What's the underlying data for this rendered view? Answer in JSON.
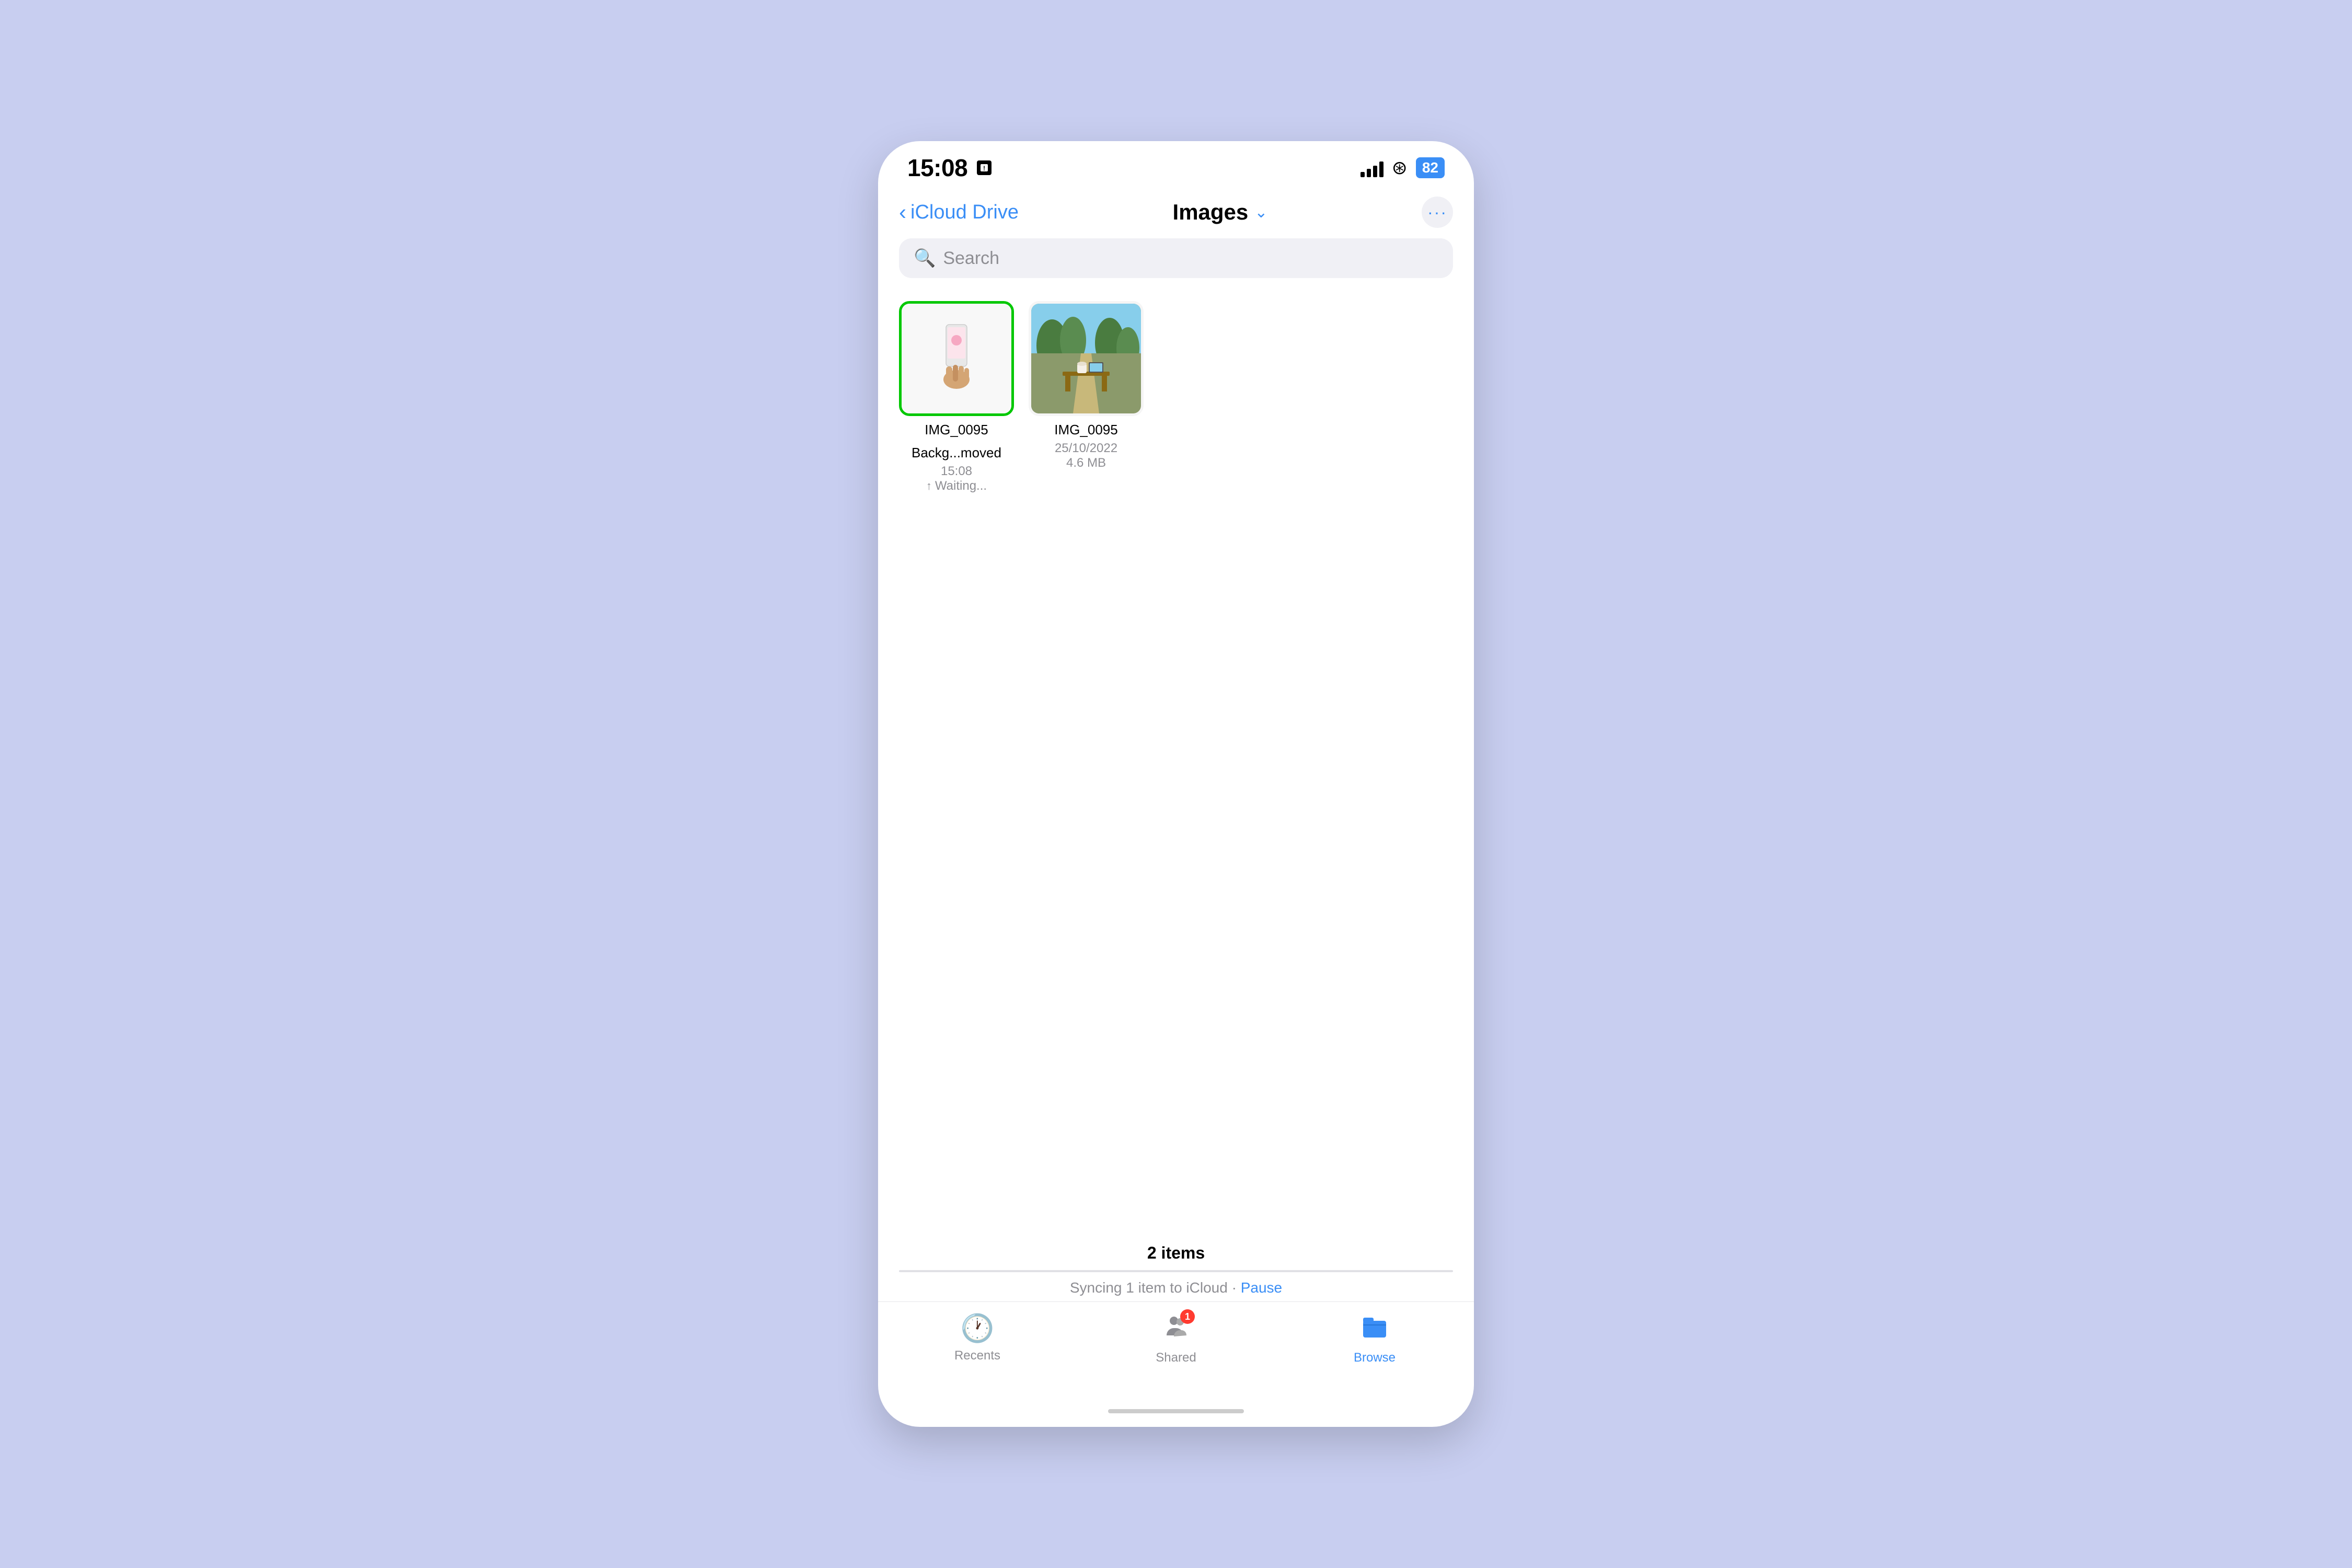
{
  "status_bar": {
    "time": "15:08",
    "battery": "82"
  },
  "nav": {
    "back_label": "iCloud Drive",
    "title": "Images",
    "more_dots": "···"
  },
  "search": {
    "placeholder": "Search"
  },
  "files": [
    {
      "id": "file1",
      "name": "IMG_0095",
      "subtitle": "Backg...moved",
      "date": "15:08",
      "status": "↑ Waiting...",
      "selected": true,
      "type": "phone"
    },
    {
      "id": "file2",
      "name": "IMG_0095",
      "subtitle": "",
      "date": "25/10/2022",
      "size": "4.6 MB",
      "selected": false,
      "type": "outdoor"
    }
  ],
  "bottom": {
    "items_count": "2 items",
    "sync_text": "Syncing 1 item to iCloud",
    "pause_label": "Pause"
  },
  "tabs": [
    {
      "id": "recents",
      "label": "Recents",
      "icon": "🕐",
      "active": false
    },
    {
      "id": "shared",
      "label": "Shared",
      "icon": "📁",
      "active": false,
      "badge": "1"
    },
    {
      "id": "browse",
      "label": "Browse",
      "icon": "📂",
      "active": true
    }
  ]
}
